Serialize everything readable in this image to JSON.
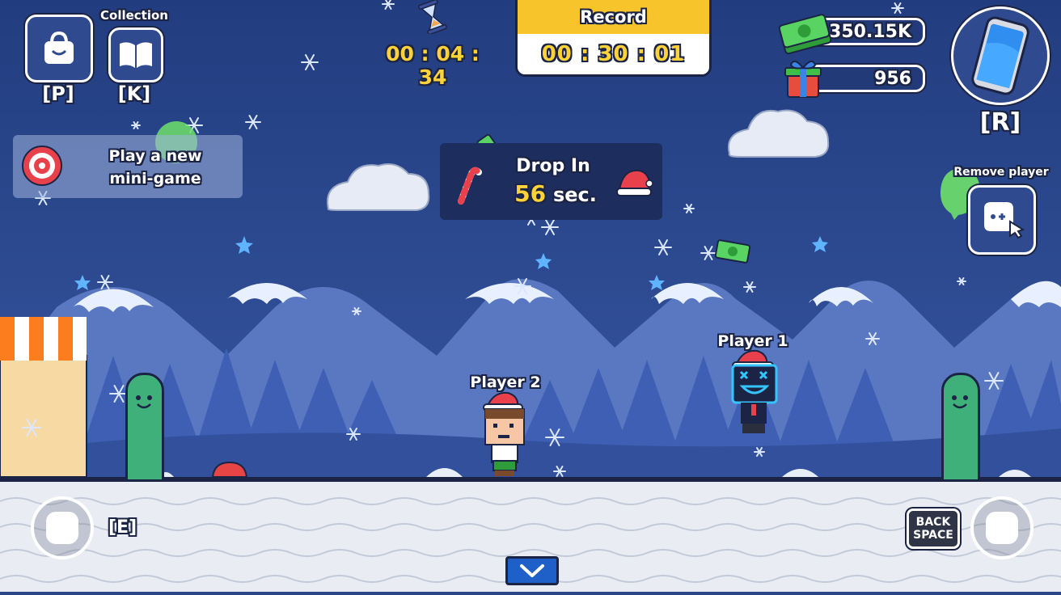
{
  "hud": {
    "shop_key": "[P]",
    "collection_title": "Collection",
    "collection_key": "[K]",
    "timer": "00 : 04 : 34",
    "record_title": "Record",
    "record_time": "00 : 30 : 01",
    "cash": "350.15K",
    "gifts": "956",
    "phone_key": "[R]",
    "remove_player_label": "Remove player"
  },
  "minigame": {
    "label": "Play a new mini-game"
  },
  "drop": {
    "title": "Drop In",
    "seconds": "56",
    "unit": "sec."
  },
  "players": [
    {
      "name": "Player 2"
    },
    {
      "name": "Player 1"
    }
  ],
  "controls": {
    "left_key": "[E]",
    "backspace_label_1": "BACK",
    "backspace_label_2": "SPACE"
  },
  "colors": {
    "sky": "#2a4688",
    "accent_yellow": "#ffd23a",
    "record_header": "#f7c42b",
    "cash_green": "#3fbf4a",
    "tube_green": "#3fb07a"
  }
}
